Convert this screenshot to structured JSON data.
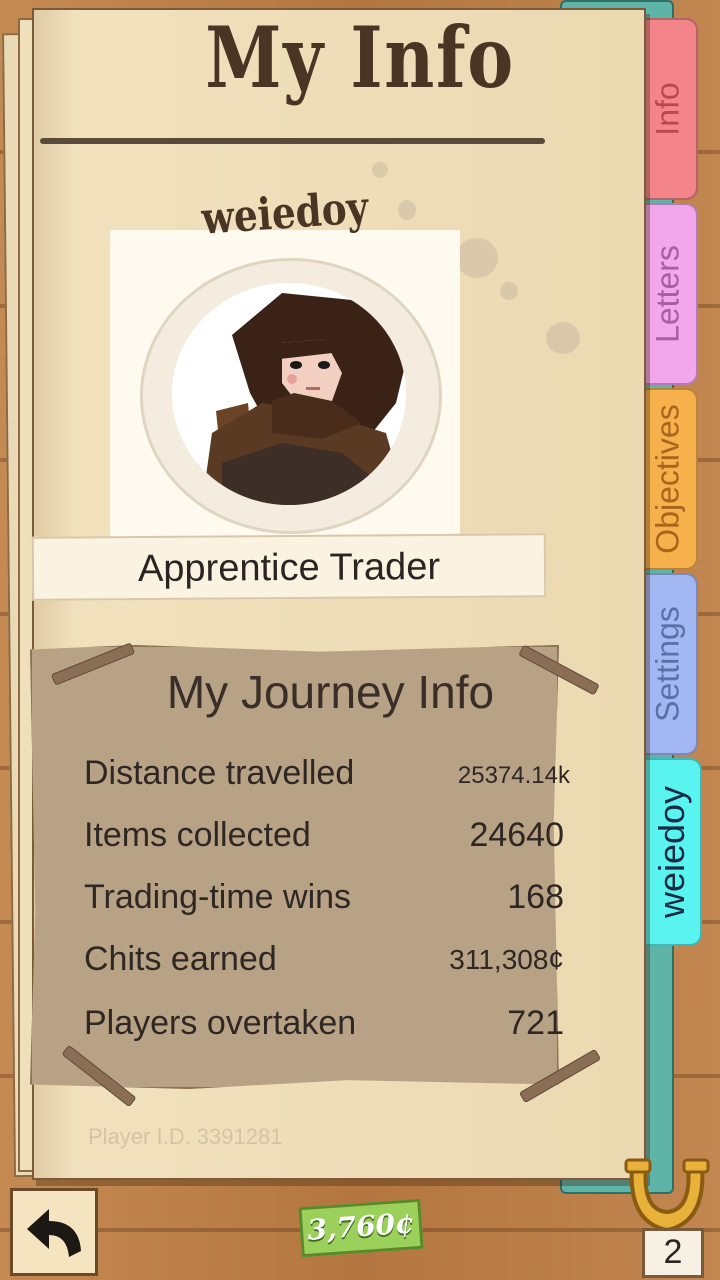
{
  "header": {
    "title": "My Info",
    "username": "weiedoy"
  },
  "profile": {
    "rank": "Apprentice Trader"
  },
  "journey": {
    "title": "My Journey Info",
    "stats": [
      {
        "label": "Distance travelled",
        "value": "25374.14k"
      },
      {
        "label": "Items collected",
        "value": "24640"
      },
      {
        "label": "Trading-time wins",
        "value": "168"
      },
      {
        "label": "Chits earned",
        "value": "311,308¢"
      },
      {
        "label": "Players overtaken",
        "value": "721"
      }
    ]
  },
  "player_id": "Player I.D. 3391281",
  "tabs": [
    {
      "label": "Info",
      "color": "#f3848a"
    },
    {
      "label": "Letters",
      "color": "#f2a6ec"
    },
    {
      "label": "Objectives",
      "color": "#f6b04c"
    },
    {
      "label": "Settings",
      "color": "#a3b7f2"
    },
    {
      "label": "weiedoy",
      "color": "#59f3f0"
    }
  ],
  "footer": {
    "currency": "3,760¢",
    "horseshoe_count": "2"
  },
  "icons": {
    "back": "back-arrow-icon",
    "horseshoe": "horseshoe-icon",
    "avatar": "avatar-portrait"
  }
}
